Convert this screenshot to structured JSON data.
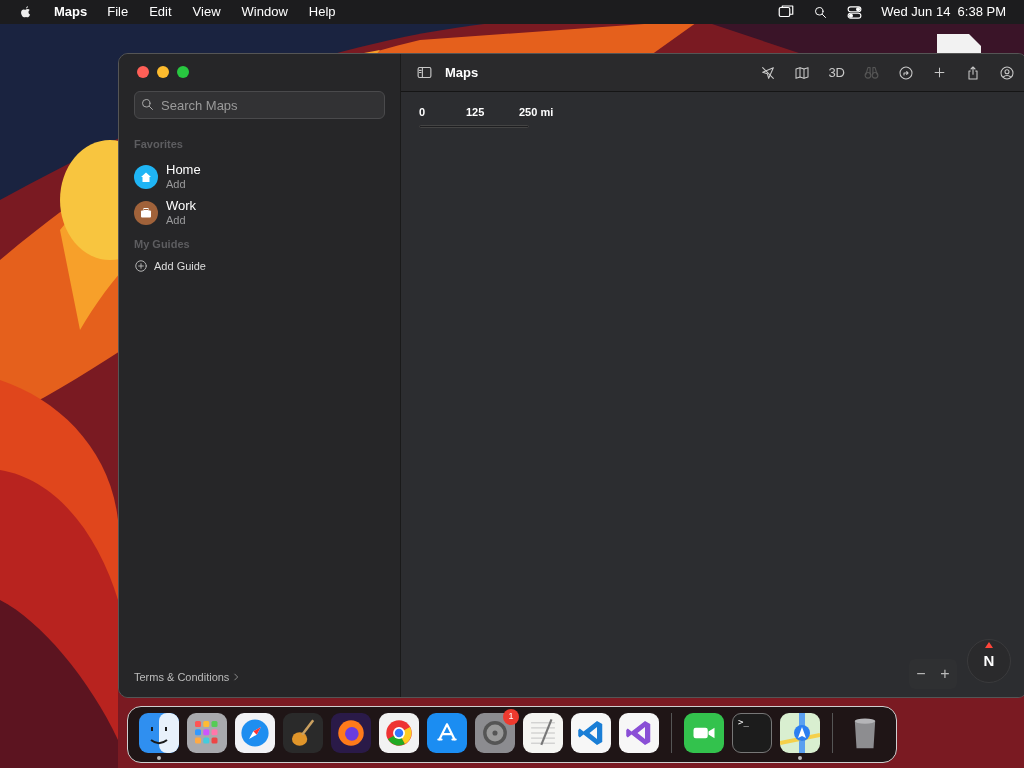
{
  "menubar": {
    "app_name": "Maps",
    "menus": [
      "File",
      "Edit",
      "View",
      "Window",
      "Help"
    ],
    "clock": "Wed Jun 14  6:38 PM"
  },
  "window": {
    "title": "Maps",
    "search": {
      "placeholder": "Search Maps"
    },
    "sections": [
      {
        "title": "Favorites",
        "items": [
          {
            "kind": "home",
            "name": "Home",
            "detail": "Add",
            "color": "#1fb5f5"
          },
          {
            "kind": "work",
            "name": "Work",
            "detail": "Add",
            "color": "#a0623a"
          }
        ]
      },
      {
        "title": "My Guides",
        "items": [
          {
            "kind": "add",
            "name": "Add Guide"
          }
        ]
      }
    ],
    "terms": "Terms & Conditions",
    "toolbar": {
      "view_3d": "3D",
      "look_around_disabled": true
    },
    "scale": [
      "0",
      "125",
      "250 mi"
    ],
    "zoom": {
      "out": "−",
      "in": "+"
    },
    "compass": "N"
  },
  "dock": [
    {
      "kind": "finder",
      "running": true
    },
    {
      "kind": "launchpad",
      "running": false
    },
    {
      "kind": "safari",
      "running": false
    },
    {
      "kind": "garageband",
      "running": false
    },
    {
      "kind": "firefox",
      "running": false
    },
    {
      "kind": "chrome",
      "running": false
    },
    {
      "kind": "appstore",
      "running": false
    },
    {
      "kind": "settings",
      "running": false,
      "badge": "1"
    },
    {
      "kind": "textedit",
      "running": false
    },
    {
      "kind": "vscode",
      "running": false
    },
    {
      "kind": "vstudio",
      "running": false
    },
    {
      "kind": "separator"
    },
    {
      "kind": "facetime",
      "running": false
    },
    {
      "kind": "terminal",
      "running": false,
      "terminal_prompt": ">_"
    },
    {
      "kind": "maps",
      "running": true
    },
    {
      "kind": "separator"
    },
    {
      "kind": "trash",
      "running": false
    }
  ]
}
